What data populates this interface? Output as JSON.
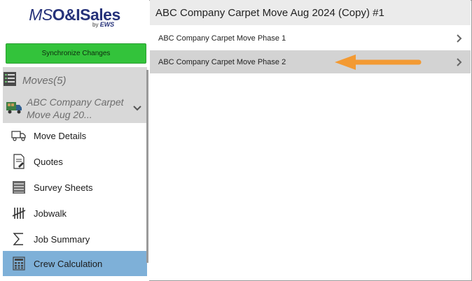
{
  "app": {
    "logo_ms": "MS",
    "logo_oi": "O&I",
    "logo_sales": "Sales",
    "logo_by": "by",
    "logo_ews": "EWS"
  },
  "sidebar": {
    "sync_label": "Synchronize Changes",
    "moves_label": "Moves(5)",
    "current_move": "ABC Company Carpet Move Aug 20...",
    "items": [
      {
        "label": "Move Details",
        "icon": "truck-icon"
      },
      {
        "label": "Quotes",
        "icon": "document-pen-icon"
      },
      {
        "label": "Survey Sheets",
        "icon": "list-sheet-icon"
      },
      {
        "label": "Jobwalk",
        "icon": "tally-icon"
      },
      {
        "label": "Job Summary",
        "icon": "sigma-icon"
      },
      {
        "label": "Crew Calculation",
        "icon": "calculator-icon",
        "active": true
      }
    ]
  },
  "main": {
    "title": "ABC Company Carpet Move Aug 2024 (Copy) #1",
    "rows": [
      {
        "label": "ABC Company Carpet Move Phase 1"
      },
      {
        "label": "ABC Company Carpet Move Phase 2",
        "selected": true
      }
    ]
  },
  "colors": {
    "sync_green": "#33c33b",
    "active_blue": "#7eb0d8",
    "arrow_orange": "#f39a33",
    "logo_navy": "#26327a"
  }
}
